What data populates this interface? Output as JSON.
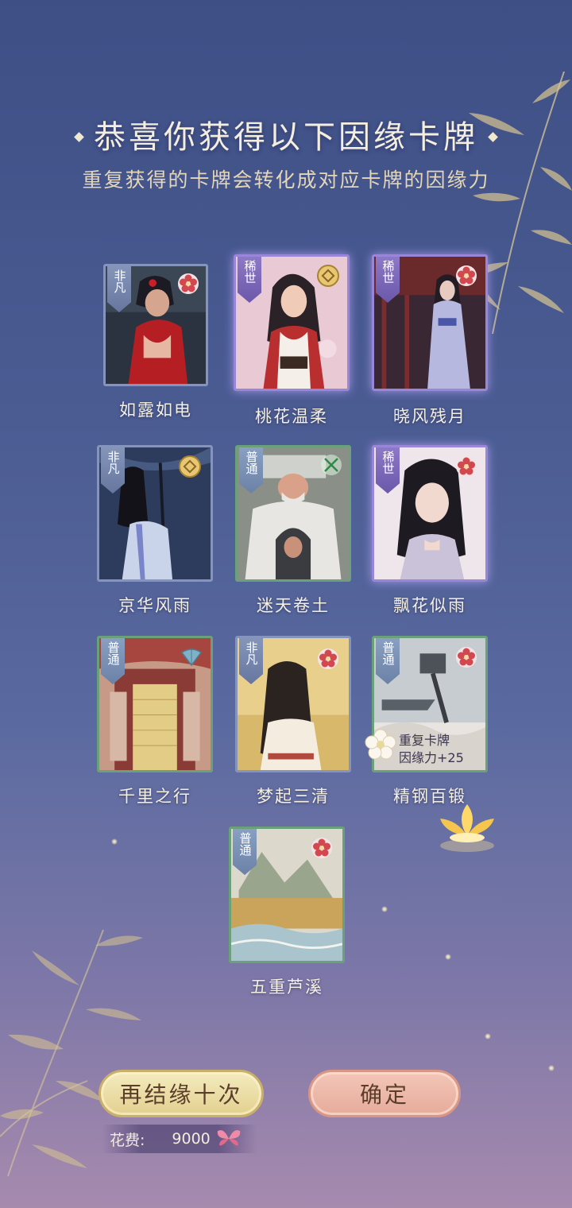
{
  "header": {
    "title": "恭喜你获得以下因缘卡牌",
    "subtitle": "重复获得的卡牌会转化成对应卡牌的因缘力"
  },
  "cards": [
    {
      "name": "如露如电",
      "tier": "非凡",
      "emblem": "plum-blossom-icon"
    },
    {
      "name": "桃花温柔",
      "tier": "稀世",
      "emblem": "gold-coin-icon"
    },
    {
      "name": "晓风残月",
      "tier": "稀世",
      "emblem": "plum-blossom-icon"
    },
    {
      "name": "京华风雨",
      "tier": "非凡",
      "emblem": "gold-coin-icon"
    },
    {
      "name": "迷天卷土",
      "tier": "普通",
      "emblem": "crossed-swords-icon"
    },
    {
      "name": "飘花似雨",
      "tier": "稀世",
      "emblem": "plum-blossom-icon"
    },
    {
      "name": "千里之行",
      "tier": "普通",
      "emblem": "fan-icon"
    },
    {
      "name": "梦起三清",
      "tier": "非凡",
      "emblem": "plum-blossom-icon"
    },
    {
      "name": "精钢百锻",
      "tier": "普通",
      "emblem": "plum-blossom-icon"
    },
    {
      "name": "五重芦溪",
      "tier": "普通",
      "emblem": "plum-blossom-icon"
    }
  ],
  "duplicate_badge": {
    "line1": "重复卡牌",
    "line2": "因缘力+25"
  },
  "buttons": {
    "again_label": "再结缘十次",
    "confirm_label": "确定"
  },
  "cost": {
    "label": "花费:",
    "amount": "9000",
    "icon": "butterfly-icon"
  },
  "colors": {
    "tier_normal_border": "#6aa17a",
    "tier_rare_border": "#9a86d8",
    "tier_extra_border": "#8494bc",
    "title_text": "#f4eee0",
    "subtitle_text": "#e4d6b6"
  }
}
